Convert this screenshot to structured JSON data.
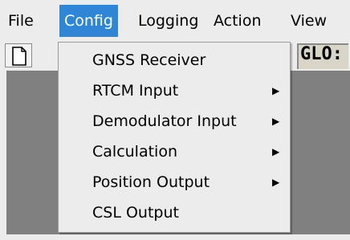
{
  "menubar": {
    "items": [
      {
        "label": "File",
        "active": false
      },
      {
        "label": "Config",
        "active": true
      },
      {
        "label": "Logging",
        "active": false
      },
      {
        "label": "Action",
        "active": false
      },
      {
        "label": "View",
        "active": false
      }
    ]
  },
  "toolbar": {
    "new_icon": "blank-page-icon",
    "readout_text": "GLO:"
  },
  "config_menu": {
    "items": [
      {
        "label": "GNSS Receiver",
        "has_submenu": false
      },
      {
        "label": "RTCM Input",
        "has_submenu": true
      },
      {
        "label": "Demodulator Input",
        "has_submenu": true
      },
      {
        "label": "Calculation",
        "has_submenu": true
      },
      {
        "label": "Position Output",
        "has_submenu": true
      },
      {
        "label": "CSL Output",
        "has_submenu": false
      }
    ],
    "submenu_icon": "submenu-arrow-icon",
    "submenu_glyph": "▶"
  },
  "colors": {
    "highlight": "#2f86d6",
    "menu_bg": "#ececec",
    "content_bg": "#808080",
    "readout_bg": "#d9d5c8"
  }
}
